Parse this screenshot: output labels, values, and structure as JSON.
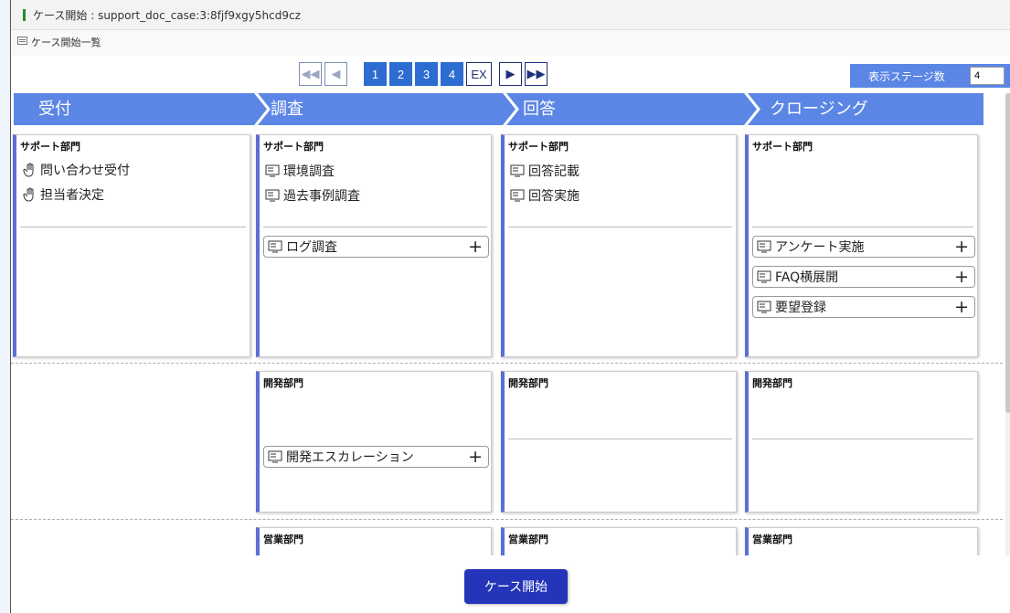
{
  "window": {
    "title": "ケース開始 : support_doc_case:3:8fjf9xgy5hcd9cz",
    "subtitle": "ケース開始一覧"
  },
  "pager": {
    "first": "◀◀",
    "prev": "◀",
    "pages": [
      "1",
      "2",
      "3",
      "4"
    ],
    "ex": "EX",
    "next": "▶",
    "last": "▶▶"
  },
  "stage_count": {
    "label": "表示ステージ数",
    "value": "4"
  },
  "stages": [
    "受付",
    "調査",
    "回答",
    "クロージング"
  ],
  "cards": {
    "support": {
      "title": "サポート部門",
      "uketsuke": {
        "tasks": [
          "問い合わせ受付",
          "担当者決定"
        ]
      },
      "chousa": {
        "tasks": [
          "環境調査",
          "過去事例調査"
        ],
        "options": [
          "ログ調査"
        ]
      },
      "kaitou": {
        "tasks": [
          "回答記載",
          "回答実施"
        ]
      },
      "closing": {
        "options": [
          "アンケート実施",
          "FAQ横展開",
          "要望登録"
        ]
      }
    },
    "dev": {
      "title": "開発部門",
      "chousa": {
        "options": [
          "開発エスカレーション"
        ]
      }
    },
    "sales": {
      "title": "営業部門"
    }
  },
  "footer": {
    "start_button": "ケース開始"
  },
  "colors": {
    "stage_header": "#5b86e5",
    "page_button": "#2d6cd1",
    "start_button": "#2435ba",
    "card_accent": "#5b6fd6"
  }
}
